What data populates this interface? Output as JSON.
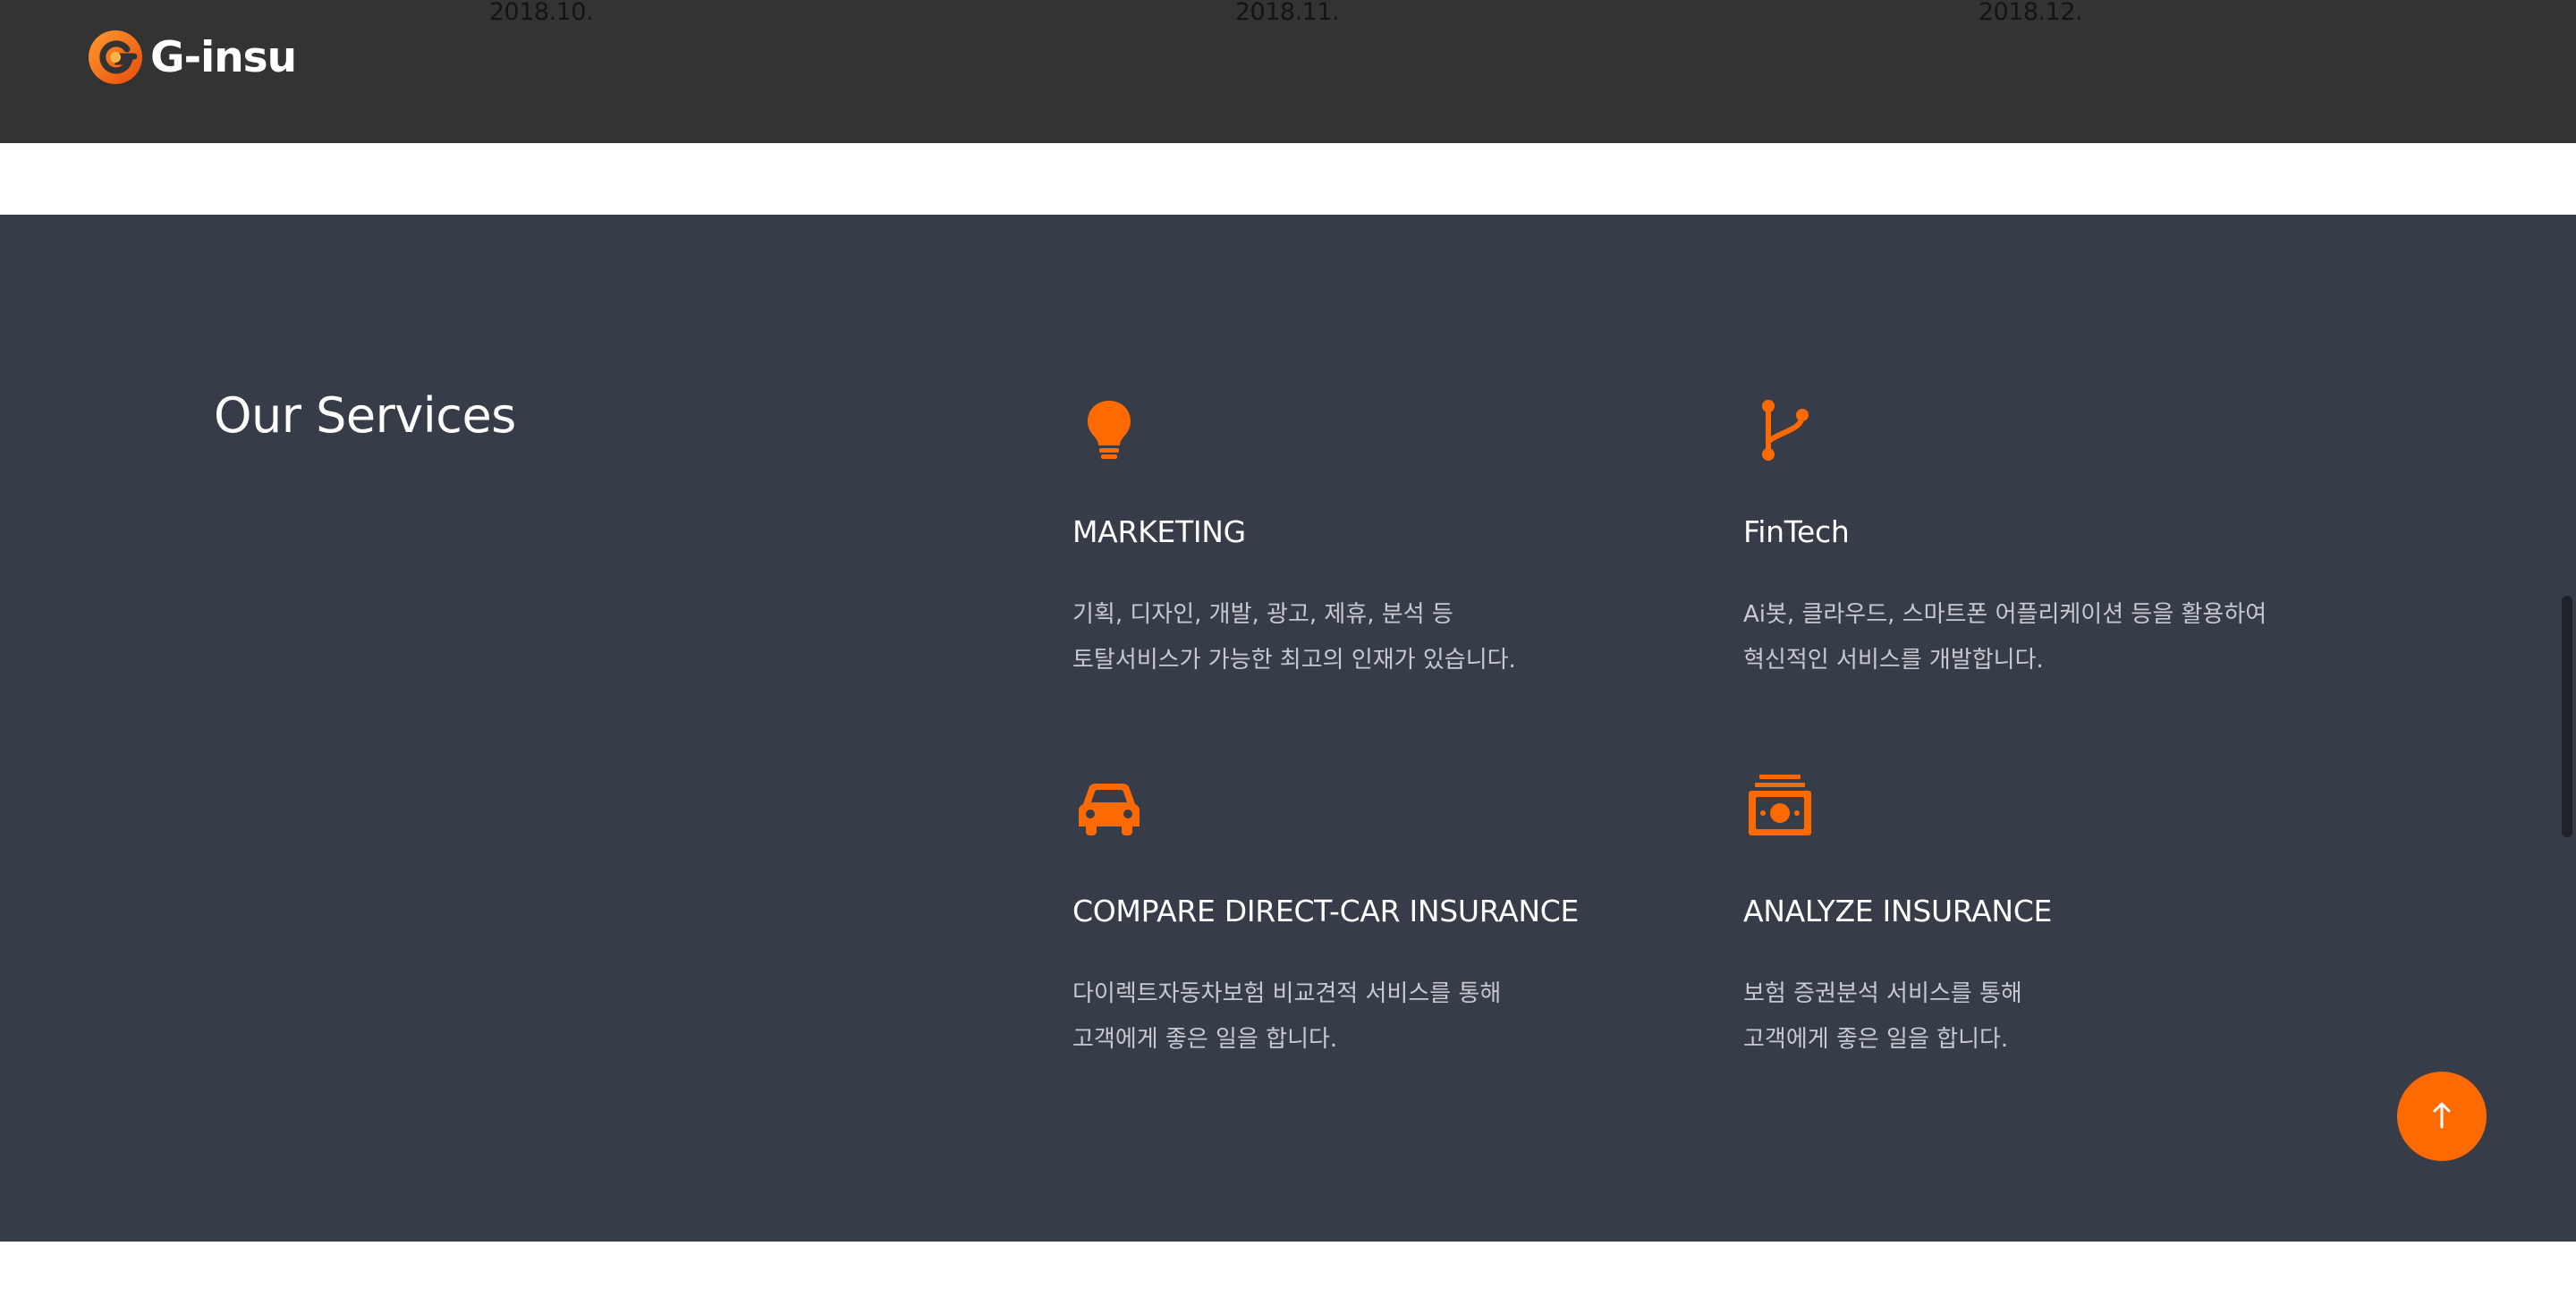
{
  "header": {
    "logo_text": "G-insu",
    "timeline_dates": [
      "2018.10.",
      "2018.11.",
      "2018.12."
    ]
  },
  "services": {
    "title": "Our Services",
    "items": [
      {
        "icon": "lightbulb-icon",
        "title": "MARKETING",
        "desc": [
          "기획, 디자인, 개발, 광고, 제휴, 분석 등",
          "토탈서비스가 가능한 최고의 인재가 있습니다."
        ]
      },
      {
        "icon": "code-branch-icon",
        "title": "FinTech",
        "desc": [
          "Ai봇, 클라우드, 스마트폰 어플리케이션 등을 활용하여",
          "혁신적인 서비스를 개발합니다."
        ]
      },
      {
        "icon": "car-icon",
        "title": "COMPARE DIRECT-CAR INSURANCE",
        "desc": [
          "다이렉트자동차보험 비교견적 서비스를 통해",
          "고객에게 좋은 일을 합니다."
        ]
      },
      {
        "icon": "money-stack-icon",
        "title": "ANALYZE INSURANCE",
        "desc": [
          "보험 증권분석 서비스를 통해",
          "고객에게 좋은 일을 합니다."
        ]
      }
    ]
  },
  "scroll_top": {
    "icon": "arrow-up-icon",
    "label": "↑"
  },
  "colors": {
    "accent": "#ff6a00",
    "header_bg": "#333333",
    "services_bg": "#373d48",
    "desc_text": "#c6c9cf"
  }
}
